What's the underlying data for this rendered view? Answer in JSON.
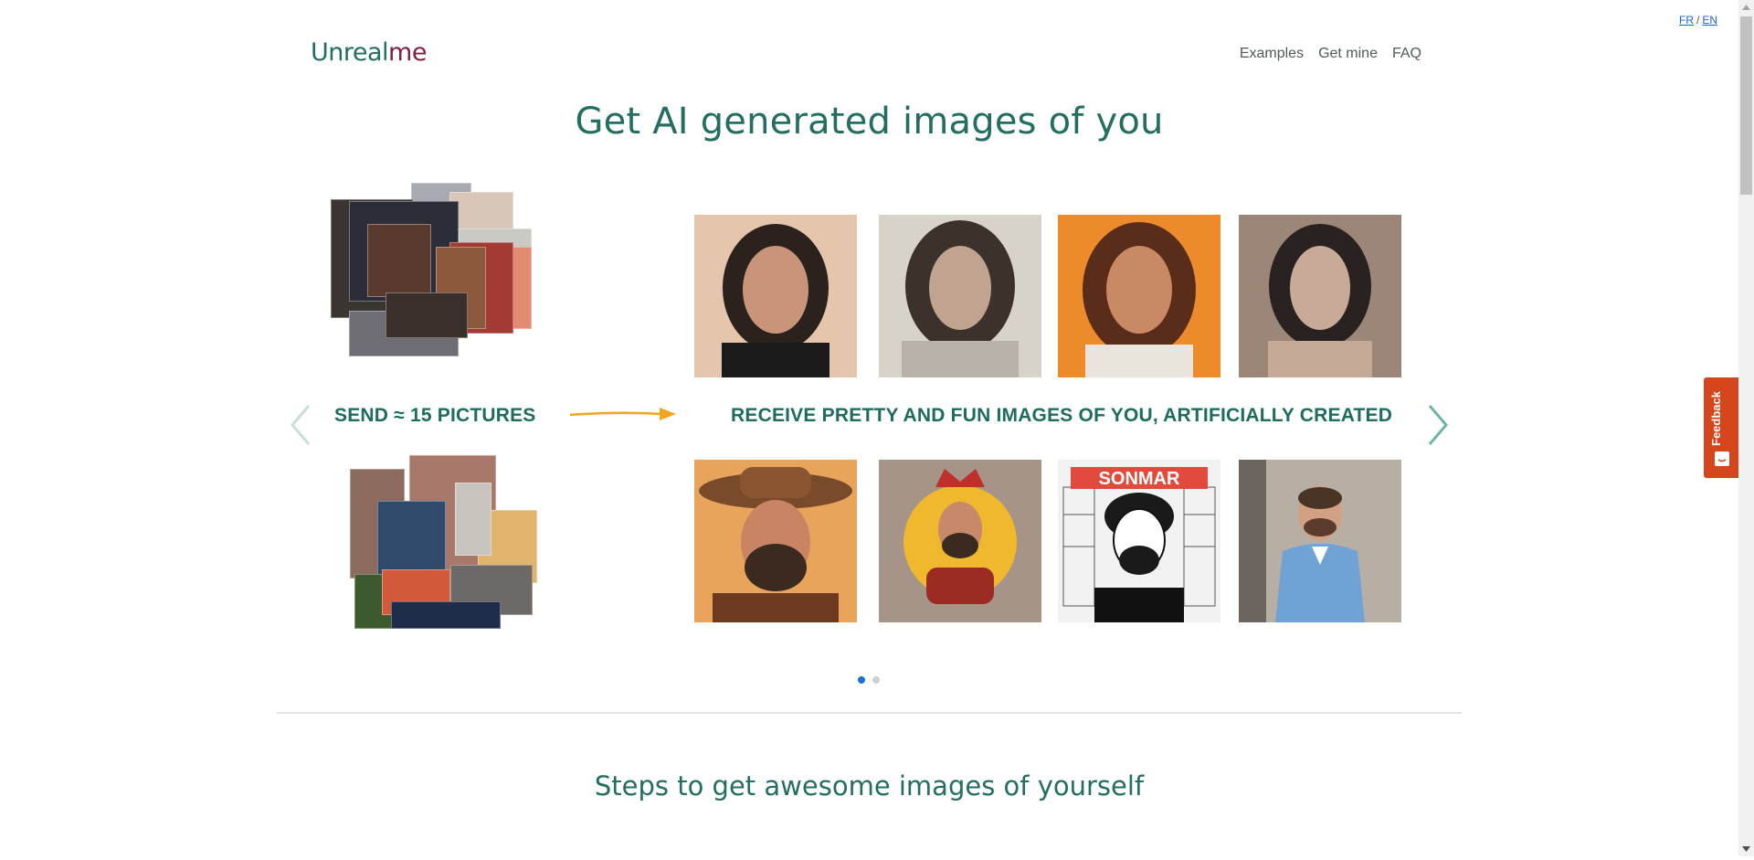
{
  "lang": {
    "fr": "FR",
    "sep": "/",
    "en": "EN"
  },
  "logo": {
    "part1": "Unreal",
    "part2": "me"
  },
  "nav": {
    "examples": "Examples",
    "get_mine": "Get mine",
    "faq": "FAQ"
  },
  "hero": {
    "title": "Get AI generated images of you"
  },
  "slider": {
    "send_label": "SEND ≈ 15 PICTURES",
    "receive_label": "RECEIVE PRETTY AND FUN IMAGES OF YOU, ARTIFICIALLY CREATED",
    "prev_icon": "chevron-left-icon",
    "next_icon": "chevron-right-icon",
    "gen_poster_text": "SONMAR",
    "active_slide": 1,
    "slide_count": 2
  },
  "steps": {
    "title": "Steps to get awesome images of yourself"
  },
  "feedback": {
    "label": "Feedback"
  },
  "colors": {
    "accent": "#236e60",
    "logo_me": "#7b2340",
    "arrow": "#f2a51f",
    "feedback": "#d6461d",
    "dot_active": "#1e6fd6"
  }
}
